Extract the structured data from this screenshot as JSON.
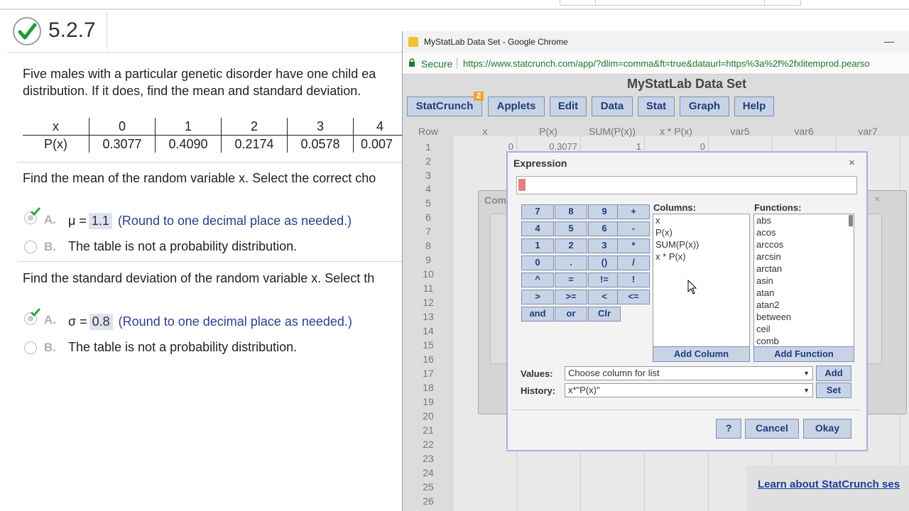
{
  "question": {
    "number": "5.2.7",
    "intro_line1": "Five males with a particular genetic disorder have one child ea",
    "intro_line2": "distribution. If it does, find the mean and standard deviation.",
    "table": {
      "header_label": "x",
      "row_label": "P(x)",
      "x_values": [
        "0",
        "1",
        "2",
        "3",
        "4"
      ],
      "p_values": [
        "0.3077",
        "0.4090",
        "0.2174",
        "0.0578",
        "0.007"
      ]
    },
    "mean_prompt": "Find the mean of the random variable x. Select the correct cho",
    "mean_option_a_letter": "A.",
    "mean_symbol": "μ =",
    "mean_value": "1.1",
    "mean_hint": "(Round to one decimal place as needed.)",
    "mean_option_b_letter": "B.",
    "mean_option_b_text": "The table is not a probability distribution.",
    "sd_prompt": "Find the standard deviation of the random variable x. Select th",
    "sd_option_a_letter": "A.",
    "sd_symbol": "σ =",
    "sd_value": "0.8",
    "sd_hint": "(Round to one decimal place as needed.)",
    "sd_option_b_letter": "B.",
    "sd_option_b_text": "The table is not a probability distribution."
  },
  "browser": {
    "window_title": "MyStatLab Data Set - Google Chrome",
    "minimize_glyph": "—",
    "secure_label": "Secure",
    "url": "https://www.statcrunch.com/app/?dlim=comma&ft=true&dataurl=https%3a%2f%2fxlitemprod.pearso"
  },
  "statcrunch": {
    "app_title": "MyStatLab Data Set",
    "menu": [
      "StatCrunch",
      "Applets",
      "Edit",
      "Data",
      "Stat",
      "Graph",
      "Help"
    ],
    "badge": "2",
    "columns": [
      "Row",
      "x",
      "P(x)",
      "SUM(P(x))",
      "x * P(x)",
      "var5",
      "var6",
      "var7"
    ],
    "rows": [
      "1",
      "2",
      "3",
      "4",
      "5",
      "6",
      "7",
      "8",
      "9",
      "10",
      "11",
      "12",
      "13",
      "14",
      "15",
      "16",
      "17",
      "18",
      "19",
      "20",
      "21",
      "22",
      "23",
      "24",
      "25",
      "26"
    ],
    "row1_values": [
      "0",
      "0.3077",
      "1",
      "0"
    ],
    "ghost_dialog_title": "Com",
    "ghost_close": "×",
    "learn_link": "Learn about StatCrunch ses"
  },
  "expression_dialog": {
    "title": "Expression",
    "close": "×",
    "keypad": [
      "7",
      "8",
      "9",
      "+",
      "4",
      "5",
      "6",
      "-",
      "1",
      "2",
      "3",
      "*",
      "0",
      ".",
      "()",
      "/",
      "^",
      "=",
      "!=",
      "!",
      ">",
      ">=",
      "<",
      "<=",
      "and",
      "or",
      "Clr"
    ],
    "columns_label": "Columns:",
    "columns": [
      "x",
      "P(x)",
      "SUM(P(x))",
      "x * P(x)"
    ],
    "functions_label": "Functions:",
    "functions": [
      "abs",
      "acos",
      "arccos",
      "arcsin",
      "arctan",
      "asin",
      "atan",
      "atan2",
      "between",
      "ceil",
      "comb"
    ],
    "add_column": "Add Column",
    "add_function": "Add Function",
    "values_label": "Values:",
    "values_placeholder": "Choose column for list",
    "values_add": "Add",
    "history_label": "History:",
    "history_value": "x*\"P(x)\"",
    "history_set": "Set",
    "help_button": "?",
    "cancel_button": "Cancel",
    "okay_button": "Okay"
  }
}
